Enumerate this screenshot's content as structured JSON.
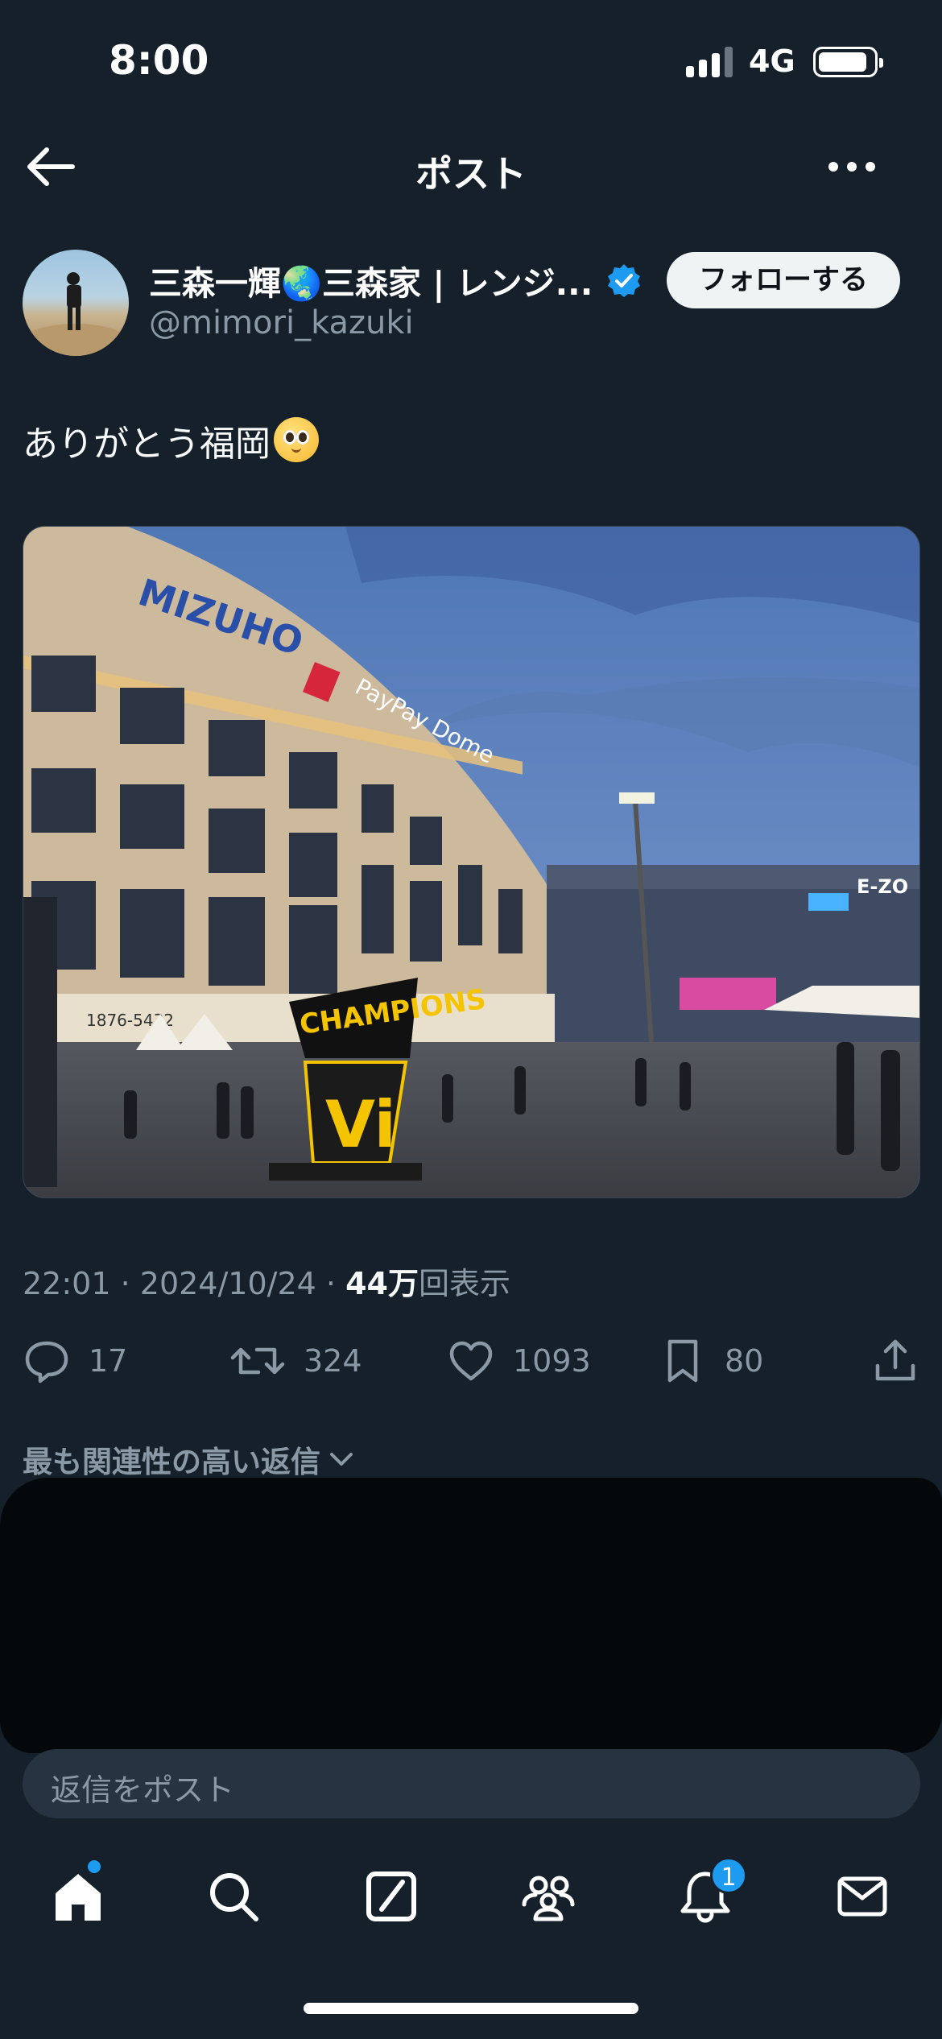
{
  "status_bar": {
    "time": "8:00",
    "network": "4G",
    "signal_bars": 3,
    "signal_bars_max": 4,
    "battery_level": 0.9
  },
  "header": {
    "title": "ポスト",
    "back_icon": "arrow-left-icon",
    "more_icon": "more-horizontal-icon"
  },
  "author": {
    "display_name": "三森一輝🌏三森家 | レンジ...",
    "handle": "@mimori_kazuki",
    "verified": true,
    "follow_label": "フォローする"
  },
  "post": {
    "text": "ありがとう福岡",
    "media_alt_signage": [
      "MIZUHO",
      "PayPay Dome",
      "CHAMPIONS",
      "Vi",
      "E-ZO",
      "1876-5432"
    ]
  },
  "meta": {
    "time": "22:01",
    "date": "2024/10/24",
    "views_count": "44万",
    "views_label": "回表示"
  },
  "actions": {
    "replies": "17",
    "reposts": "324",
    "likes": "1093",
    "bookmarks": "80"
  },
  "replies_section": {
    "sort_label": "最も関連性の高い返信"
  },
  "reply_input": {
    "placeholder": "返信をポスト"
  },
  "tabbar": {
    "items": [
      "home-icon",
      "search-icon",
      "grok-icon",
      "communities-icon",
      "notifications-icon",
      "messages-icon"
    ],
    "notification_count": "1"
  },
  "colors": {
    "background": "#15202b",
    "accent": "#1d9bf0",
    "muted": "#8b98a5"
  }
}
